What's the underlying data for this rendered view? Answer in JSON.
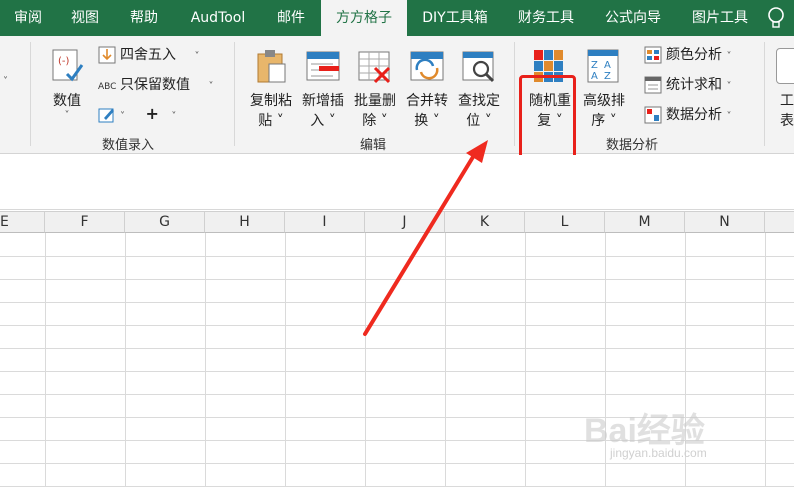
{
  "tabs": [
    "审阅",
    "视图",
    "帮助",
    "AudTool",
    "邮件",
    "方方格子",
    "DIY工具箱",
    "财务工具",
    "公式向导",
    "图片工具"
  ],
  "active_tab": "方方格子",
  "groups": {
    "numeric": {
      "label": "数值录入",
      "big_button": {
        "l1": "数值",
        "l2": "˅"
      },
      "small": [
        "四舍五入",
        "只保留数值"
      ],
      "plus": "+"
    },
    "edit": {
      "label": "编辑",
      "buttons": [
        {
          "l1": "复制粘",
          "l2": "贴 ˅"
        },
        {
          "l1": "新增插",
          "l2": "入 ˅"
        },
        {
          "l1": "批量删",
          "l2": "除 ˅"
        },
        {
          "l1": "合并转",
          "l2": "换 ˅"
        },
        {
          "l1": "查找定",
          "l2": "位 ˅"
        }
      ]
    },
    "analysis": {
      "label": "数据分析",
      "buttons": [
        {
          "l1": "随机重",
          "l2": "复 ˅"
        },
        {
          "l1": "高级排",
          "l2": "序 ˅"
        }
      ],
      "small": [
        "颜色分析",
        "统计求和",
        "数据分析"
      ]
    },
    "partial": {
      "l1": "工",
      "l2": "表"
    }
  },
  "columns": [
    "E",
    "F",
    "G",
    "H",
    "I",
    "J",
    "K",
    "L",
    "M",
    "N"
  ],
  "watermark": {
    "text": "Bai经验",
    "sub": "jingyan.baidu.com"
  }
}
